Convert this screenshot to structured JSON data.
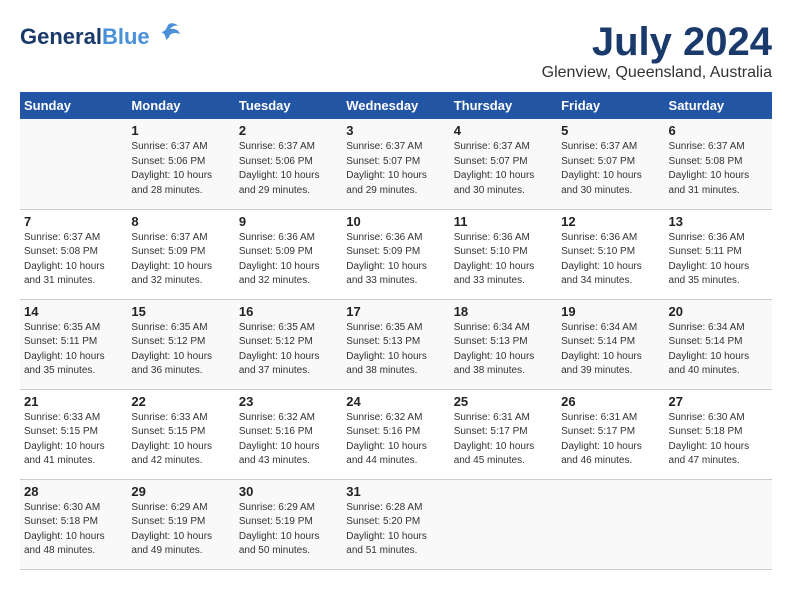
{
  "logo": {
    "general": "General",
    "blue": "Blue"
  },
  "title": {
    "month_year": "July 2024",
    "location": "Glenview, Queensland, Australia"
  },
  "weekdays": [
    "Sunday",
    "Monday",
    "Tuesday",
    "Wednesday",
    "Thursday",
    "Friday",
    "Saturday"
  ],
  "weeks": [
    [
      {
        "day": "",
        "info": ""
      },
      {
        "day": "1",
        "info": "Sunrise: 6:37 AM\nSunset: 5:06 PM\nDaylight: 10 hours\nand 28 minutes."
      },
      {
        "day": "2",
        "info": "Sunrise: 6:37 AM\nSunset: 5:06 PM\nDaylight: 10 hours\nand 29 minutes."
      },
      {
        "day": "3",
        "info": "Sunrise: 6:37 AM\nSunset: 5:07 PM\nDaylight: 10 hours\nand 29 minutes."
      },
      {
        "day": "4",
        "info": "Sunrise: 6:37 AM\nSunset: 5:07 PM\nDaylight: 10 hours\nand 30 minutes."
      },
      {
        "day": "5",
        "info": "Sunrise: 6:37 AM\nSunset: 5:07 PM\nDaylight: 10 hours\nand 30 minutes."
      },
      {
        "day": "6",
        "info": "Sunrise: 6:37 AM\nSunset: 5:08 PM\nDaylight: 10 hours\nand 31 minutes."
      }
    ],
    [
      {
        "day": "7",
        "info": "Sunrise: 6:37 AM\nSunset: 5:08 PM\nDaylight: 10 hours\nand 31 minutes."
      },
      {
        "day": "8",
        "info": "Sunrise: 6:37 AM\nSunset: 5:09 PM\nDaylight: 10 hours\nand 32 minutes."
      },
      {
        "day": "9",
        "info": "Sunrise: 6:36 AM\nSunset: 5:09 PM\nDaylight: 10 hours\nand 32 minutes."
      },
      {
        "day": "10",
        "info": "Sunrise: 6:36 AM\nSunset: 5:09 PM\nDaylight: 10 hours\nand 33 minutes."
      },
      {
        "day": "11",
        "info": "Sunrise: 6:36 AM\nSunset: 5:10 PM\nDaylight: 10 hours\nand 33 minutes."
      },
      {
        "day": "12",
        "info": "Sunrise: 6:36 AM\nSunset: 5:10 PM\nDaylight: 10 hours\nand 34 minutes."
      },
      {
        "day": "13",
        "info": "Sunrise: 6:36 AM\nSunset: 5:11 PM\nDaylight: 10 hours\nand 35 minutes."
      }
    ],
    [
      {
        "day": "14",
        "info": "Sunrise: 6:35 AM\nSunset: 5:11 PM\nDaylight: 10 hours\nand 35 minutes."
      },
      {
        "day": "15",
        "info": "Sunrise: 6:35 AM\nSunset: 5:12 PM\nDaylight: 10 hours\nand 36 minutes."
      },
      {
        "day": "16",
        "info": "Sunrise: 6:35 AM\nSunset: 5:12 PM\nDaylight: 10 hours\nand 37 minutes."
      },
      {
        "day": "17",
        "info": "Sunrise: 6:35 AM\nSunset: 5:13 PM\nDaylight: 10 hours\nand 38 minutes."
      },
      {
        "day": "18",
        "info": "Sunrise: 6:34 AM\nSunset: 5:13 PM\nDaylight: 10 hours\nand 38 minutes."
      },
      {
        "day": "19",
        "info": "Sunrise: 6:34 AM\nSunset: 5:14 PM\nDaylight: 10 hours\nand 39 minutes."
      },
      {
        "day": "20",
        "info": "Sunrise: 6:34 AM\nSunset: 5:14 PM\nDaylight: 10 hours\nand 40 minutes."
      }
    ],
    [
      {
        "day": "21",
        "info": "Sunrise: 6:33 AM\nSunset: 5:15 PM\nDaylight: 10 hours\nand 41 minutes."
      },
      {
        "day": "22",
        "info": "Sunrise: 6:33 AM\nSunset: 5:15 PM\nDaylight: 10 hours\nand 42 minutes."
      },
      {
        "day": "23",
        "info": "Sunrise: 6:32 AM\nSunset: 5:16 PM\nDaylight: 10 hours\nand 43 minutes."
      },
      {
        "day": "24",
        "info": "Sunrise: 6:32 AM\nSunset: 5:16 PM\nDaylight: 10 hours\nand 44 minutes."
      },
      {
        "day": "25",
        "info": "Sunrise: 6:31 AM\nSunset: 5:17 PM\nDaylight: 10 hours\nand 45 minutes."
      },
      {
        "day": "26",
        "info": "Sunrise: 6:31 AM\nSunset: 5:17 PM\nDaylight: 10 hours\nand 46 minutes."
      },
      {
        "day": "27",
        "info": "Sunrise: 6:30 AM\nSunset: 5:18 PM\nDaylight: 10 hours\nand 47 minutes."
      }
    ],
    [
      {
        "day": "28",
        "info": "Sunrise: 6:30 AM\nSunset: 5:18 PM\nDaylight: 10 hours\nand 48 minutes."
      },
      {
        "day": "29",
        "info": "Sunrise: 6:29 AM\nSunset: 5:19 PM\nDaylight: 10 hours\nand 49 minutes."
      },
      {
        "day": "30",
        "info": "Sunrise: 6:29 AM\nSunset: 5:19 PM\nDaylight: 10 hours\nand 50 minutes."
      },
      {
        "day": "31",
        "info": "Sunrise: 6:28 AM\nSunset: 5:20 PM\nDaylight: 10 hours\nand 51 minutes."
      },
      {
        "day": "",
        "info": ""
      },
      {
        "day": "",
        "info": ""
      },
      {
        "day": "",
        "info": ""
      }
    ]
  ]
}
